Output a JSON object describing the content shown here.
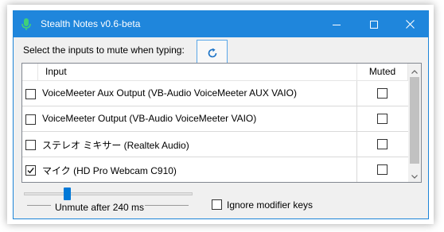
{
  "window": {
    "title": "Stealth Notes v0.6-beta",
    "accent_color": "#1f86dc",
    "icon": "microphone-icon",
    "controls": [
      "minimize-icon",
      "maximize-icon",
      "close-icon"
    ]
  },
  "prompt": {
    "label": "Select the inputs to mute when typing:",
    "refresh_icon": "refresh-icon"
  },
  "inputs_table": {
    "columns": [
      "",
      "Input",
      "Muted"
    ],
    "rows": [
      {
        "selected": false,
        "name": "VoiceMeeter Aux Output (VB-Audio VoiceMeeter AUX VAIO)",
        "muted": false
      },
      {
        "selected": false,
        "name": "VoiceMeeter Output (VB-Audio VoiceMeeter VAIO)",
        "muted": false
      },
      {
        "selected": false,
        "name": "ステレオ ミキサー (Realtek Audio)",
        "muted": false
      },
      {
        "selected": true,
        "name": "マイク (HD Pro Webcam C910)",
        "muted": false
      }
    ]
  },
  "unmute_slider": {
    "caption": "Unmute after 240 ms",
    "level_fraction": 0.24
  },
  "options": {
    "ignore_modifier_label": "Ignore modifier keys",
    "ignore_modifier_checked": false
  }
}
